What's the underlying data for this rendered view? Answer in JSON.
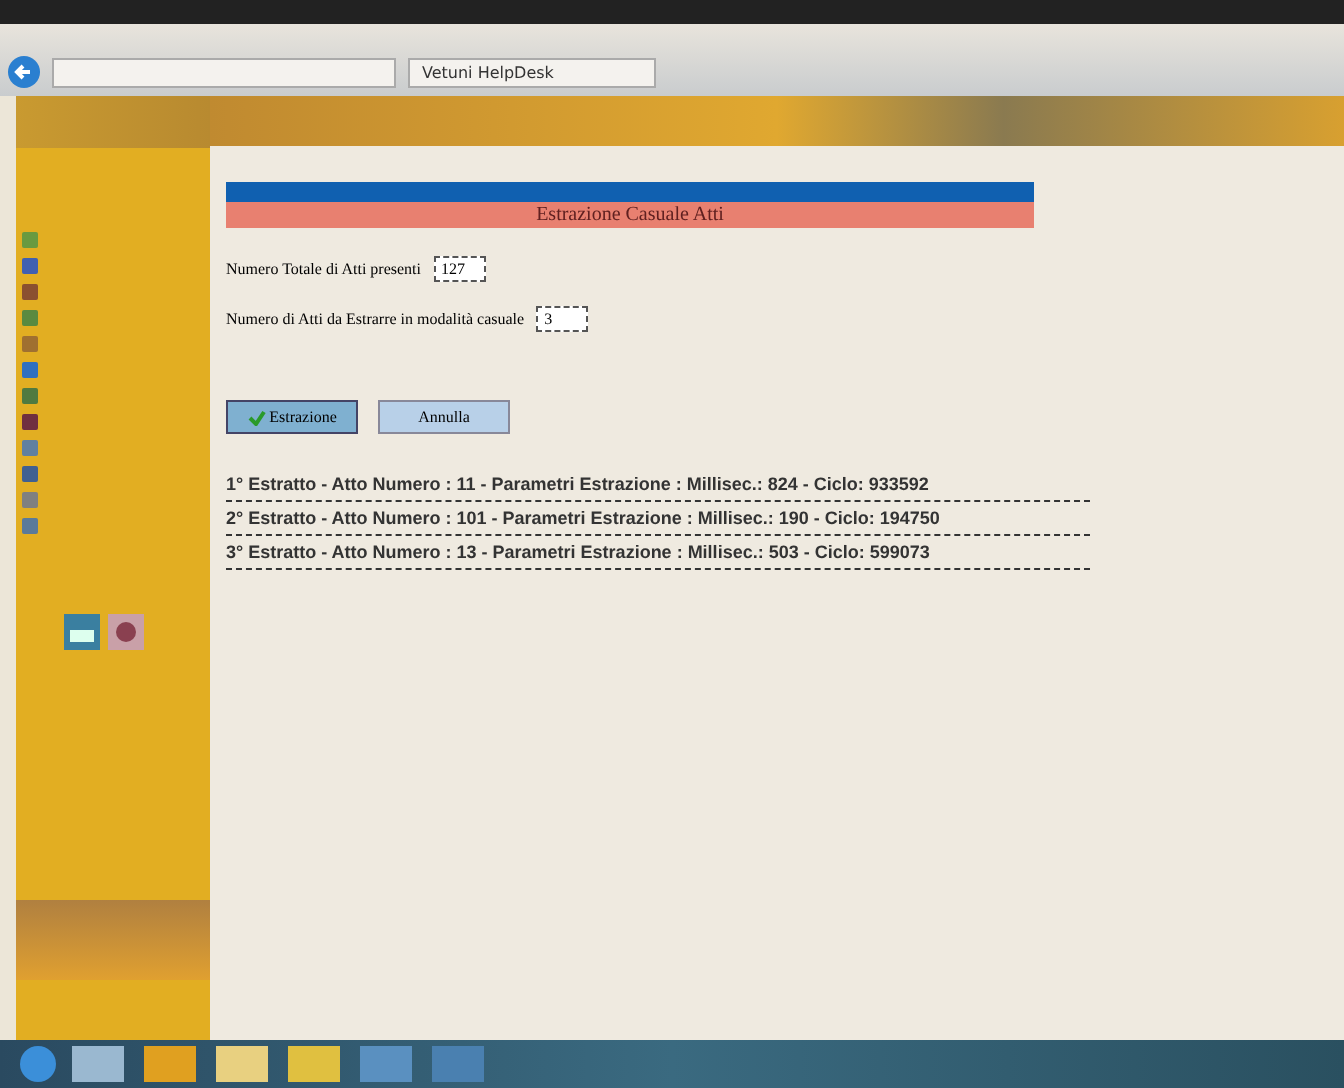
{
  "browser": {
    "tab_title": "Vetuni HelpDesk"
  },
  "panel": {
    "title": "Estrazione Casuale Atti"
  },
  "fields": [
    {
      "label": "Numero Totale di Atti presenti",
      "value": "127"
    },
    {
      "label": "Numero di Atti da Estrarre in modalità casuale",
      "value": "3"
    }
  ],
  "buttons": [
    {
      "label": "Estrazione",
      "kind": "confirm"
    },
    {
      "label": "Annulla",
      "kind": "cancel"
    }
  ],
  "results": [
    "1° Estratto - Atto Numero : 11 - Parametri Estrazione : Millisec.: 824 - Ciclo: 933592",
    "2° Estratto - Atto Numero : 101 - Parametri Estrazione : Millisec.: 190 - Ciclo: 194750",
    "3° Estratto - Atto Numero : 13 - Parametri Estrazione : Millisec.: 503 - Ciclo: 599073"
  ]
}
